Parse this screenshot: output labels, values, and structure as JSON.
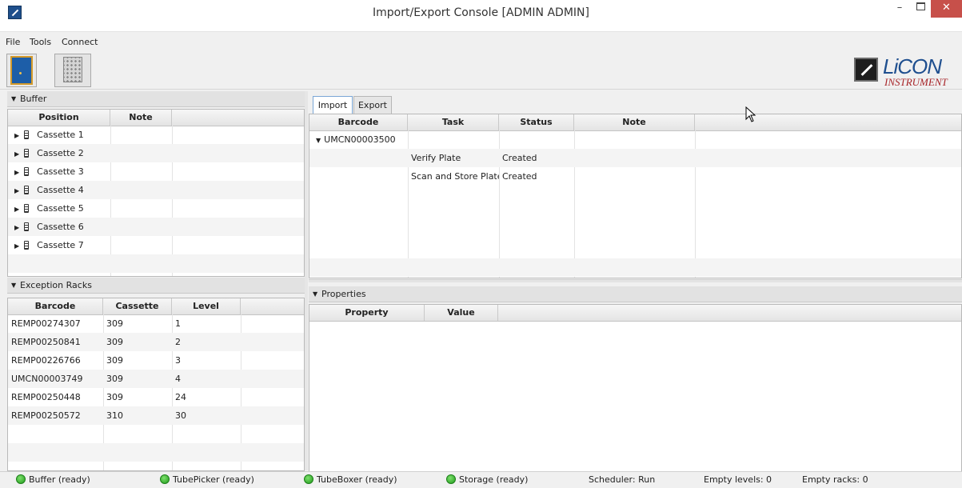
{
  "window": {
    "title": "Import/Export Console [ADMIN ADMIN]",
    "minimize_glyph": "–",
    "close_glyph": "✕"
  },
  "menu": {
    "items": [
      "File",
      "Tools",
      "Connect"
    ]
  },
  "toolbar": {
    "door_icon": "door-icon",
    "rack_icon": "rack-icon"
  },
  "logo": {
    "top": "LiCON",
    "bottom": "INSTRUMENT"
  },
  "buffer": {
    "title": "Buffer",
    "columns": [
      "Position",
      "Note"
    ],
    "rows": [
      "Cassette 1",
      "Cassette 2",
      "Cassette 3",
      "Cassette 4",
      "Cassette 5",
      "Cassette 6",
      "Cassette 7"
    ]
  },
  "exception_racks": {
    "title": "Exception Racks",
    "columns": [
      "Barcode",
      "Cassette",
      "Level"
    ],
    "rows": [
      [
        "REMP00274307",
        "309",
        "1"
      ],
      [
        "REMP00250841",
        "309",
        "2"
      ],
      [
        "REMP00226766",
        "309",
        "3"
      ],
      [
        "UMCN00003749",
        "309",
        "4"
      ],
      [
        "REMP00250448",
        "309",
        "24"
      ],
      [
        "REMP00250572",
        "310",
        "30"
      ]
    ]
  },
  "tabs": [
    "Import",
    "Export"
  ],
  "import_table": {
    "columns": [
      "Barcode",
      "Task",
      "Status",
      "Note"
    ],
    "group": "UMCN00003500",
    "rows": [
      [
        "",
        "Verify Plate",
        "Created",
        ""
      ],
      [
        "",
        "Scan and Store Plate",
        "Created",
        ""
      ]
    ]
  },
  "properties": {
    "title": "Properties",
    "columns": [
      "Property",
      "Value"
    ]
  },
  "status": {
    "buffer": "Buffer (ready)",
    "tubepicker": "TubePicker (ready)",
    "tubeboxer": "TubeBoxer (ready)",
    "storage": "Storage (ready)",
    "scheduler": "Scheduler: Run",
    "empty_levels": "Empty levels: 0",
    "empty_racks": "Empty racks: 0"
  }
}
